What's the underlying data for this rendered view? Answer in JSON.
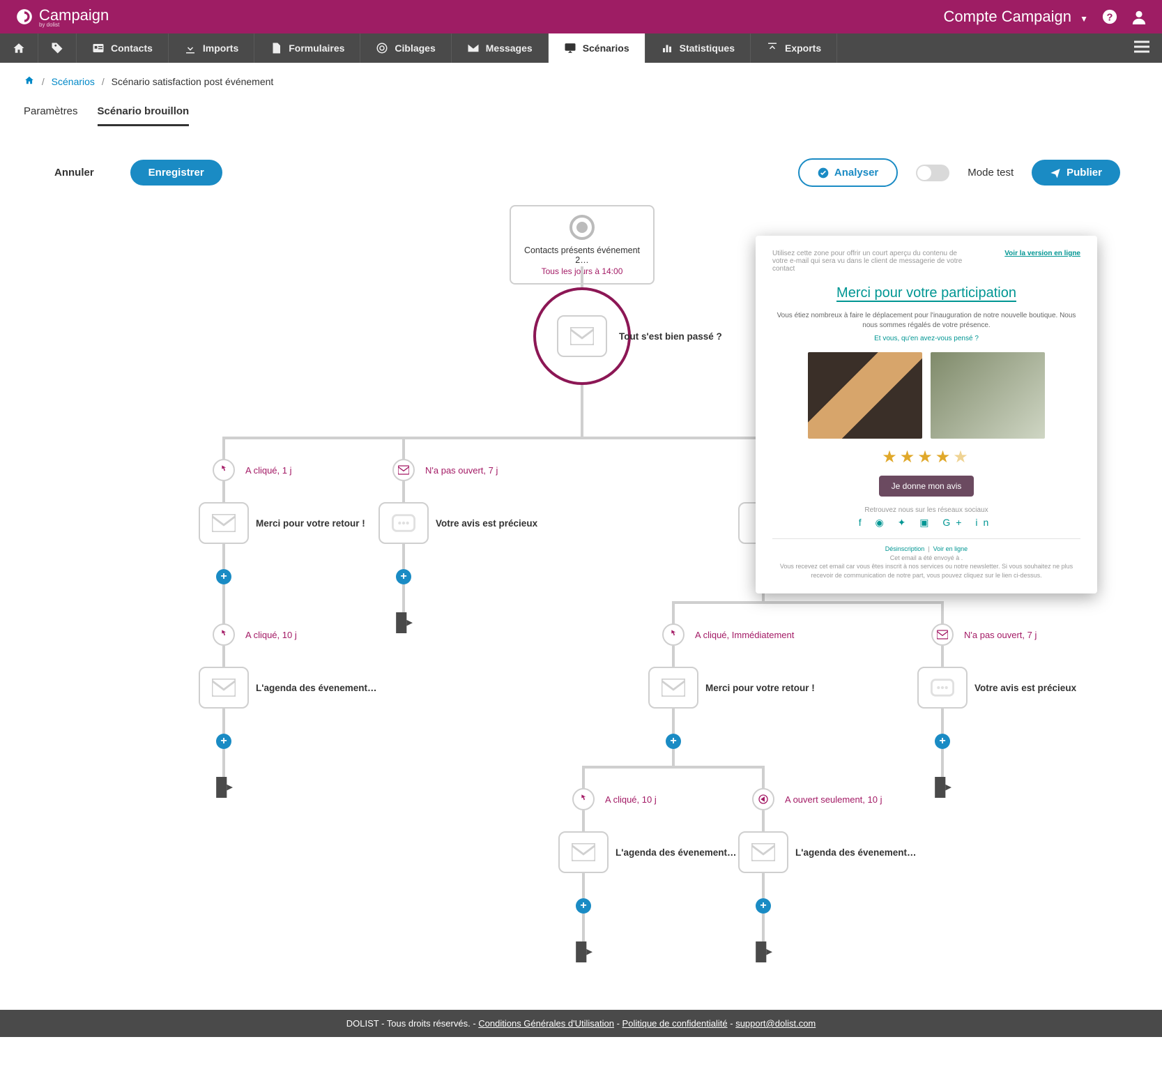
{
  "header": {
    "brand": "Campaign",
    "brand_sub": "by dolist",
    "account": "Compte Campaign"
  },
  "nav": {
    "items": [
      {
        "id": "home",
        "label": ""
      },
      {
        "id": "tag",
        "label": ""
      },
      {
        "id": "contacts",
        "label": "Contacts"
      },
      {
        "id": "imports",
        "label": "Imports"
      },
      {
        "id": "forms",
        "label": "Formulaires"
      },
      {
        "id": "targets",
        "label": "Ciblages"
      },
      {
        "id": "messages",
        "label": "Messages"
      },
      {
        "id": "scenarios",
        "label": "Scénarios"
      },
      {
        "id": "stats",
        "label": "Statistiques"
      },
      {
        "id": "exports",
        "label": "Exports"
      }
    ],
    "active": "scenarios"
  },
  "breadcrumb": {
    "root": "Scénarios",
    "current": "Scénario satisfaction post événement"
  },
  "ptabs": {
    "items": [
      {
        "id": "params",
        "label": "Paramètres"
      },
      {
        "id": "draft",
        "label": "Scénario brouillon"
      }
    ],
    "active": "draft"
  },
  "toolbar": {
    "cancel": "Annuler",
    "save": "Enregistrer",
    "analyze": "Analyser",
    "test_mode": "Mode test",
    "publish": "Publier"
  },
  "flow": {
    "start": {
      "title": "Contacts présents événement 2…",
      "schedule": "Tous les jours à 14:00"
    },
    "root_msg": {
      "label": "Tout s'est bien passé ?"
    },
    "branches": [
      {
        "cond": "A cliqué,  1 j",
        "msg": "Merci pour votre retour !",
        "icon": "click"
      },
      {
        "cond": "N'a pas ouvert,  7 j",
        "msg": "Votre avis est précieux",
        "icon": "mail"
      },
      {
        "cond": "",
        "msg": "",
        "hidden": true
      },
      {
        "cond": "",
        "msg": "",
        "hidden": true
      }
    ],
    "b1_children": [
      {
        "cond": "A cliqué,  10 j",
        "msg": "L'agenda des évenement…",
        "icon": "click"
      }
    ],
    "b4_children": [
      {
        "cond": "A cliqué,  Immédiatement",
        "msg": "Merci pour votre retour !",
        "icon": "click"
      },
      {
        "cond": "N'a pas ouvert,  7 j",
        "msg": "Votre avis est précieux",
        "icon": "mail"
      }
    ],
    "b4c1_children": [
      {
        "cond": "A cliqué,  10 j",
        "msg": "L'agenda des évenement…",
        "icon": "click"
      },
      {
        "cond": "A ouvert seulement,  10 j",
        "msg": "L'agenda des évenement…",
        "icon": "open"
      }
    ]
  },
  "preview": {
    "pre": "Utilisez cette zone pour offrir un court aperçu du contenu de votre e-mail qui sera vu dans le client de messagerie de votre contact",
    "online": "Voir la version en ligne",
    "title_a": "Merci pour ",
    "title_b": "votre",
    "title_c": " participation",
    "p1": "Vous étiez nombreux à faire le déplacement pour l'inauguration de notre nouvelle boutique. Nous nous sommes régalés de votre présence.",
    "p2": "Et vous, qu'en avez-vous pensé ?",
    "cta": "Je donne mon avis",
    "soc_label": "Retrouvez nous sur les réseaux sociaux",
    "unsub": "Désinscription",
    "view": "Voir en ligne",
    "sent": "Cet email a été envoyé à .",
    "disc": "Vous recevez cet email car vous êtes inscrit à nos services ou notre newsletter. Si vous souhaitez ne plus recevoir de communication de notre part, vous pouvez cliquez sur le lien ci-dessus."
  },
  "footer": {
    "copy": "DOLIST - Tous droits réservés. - ",
    "cgu": "Conditions Générales d'Utilisation",
    "sep": " - ",
    "priv": "Politique de confidentialité",
    "mail": "support@dolist.com"
  }
}
